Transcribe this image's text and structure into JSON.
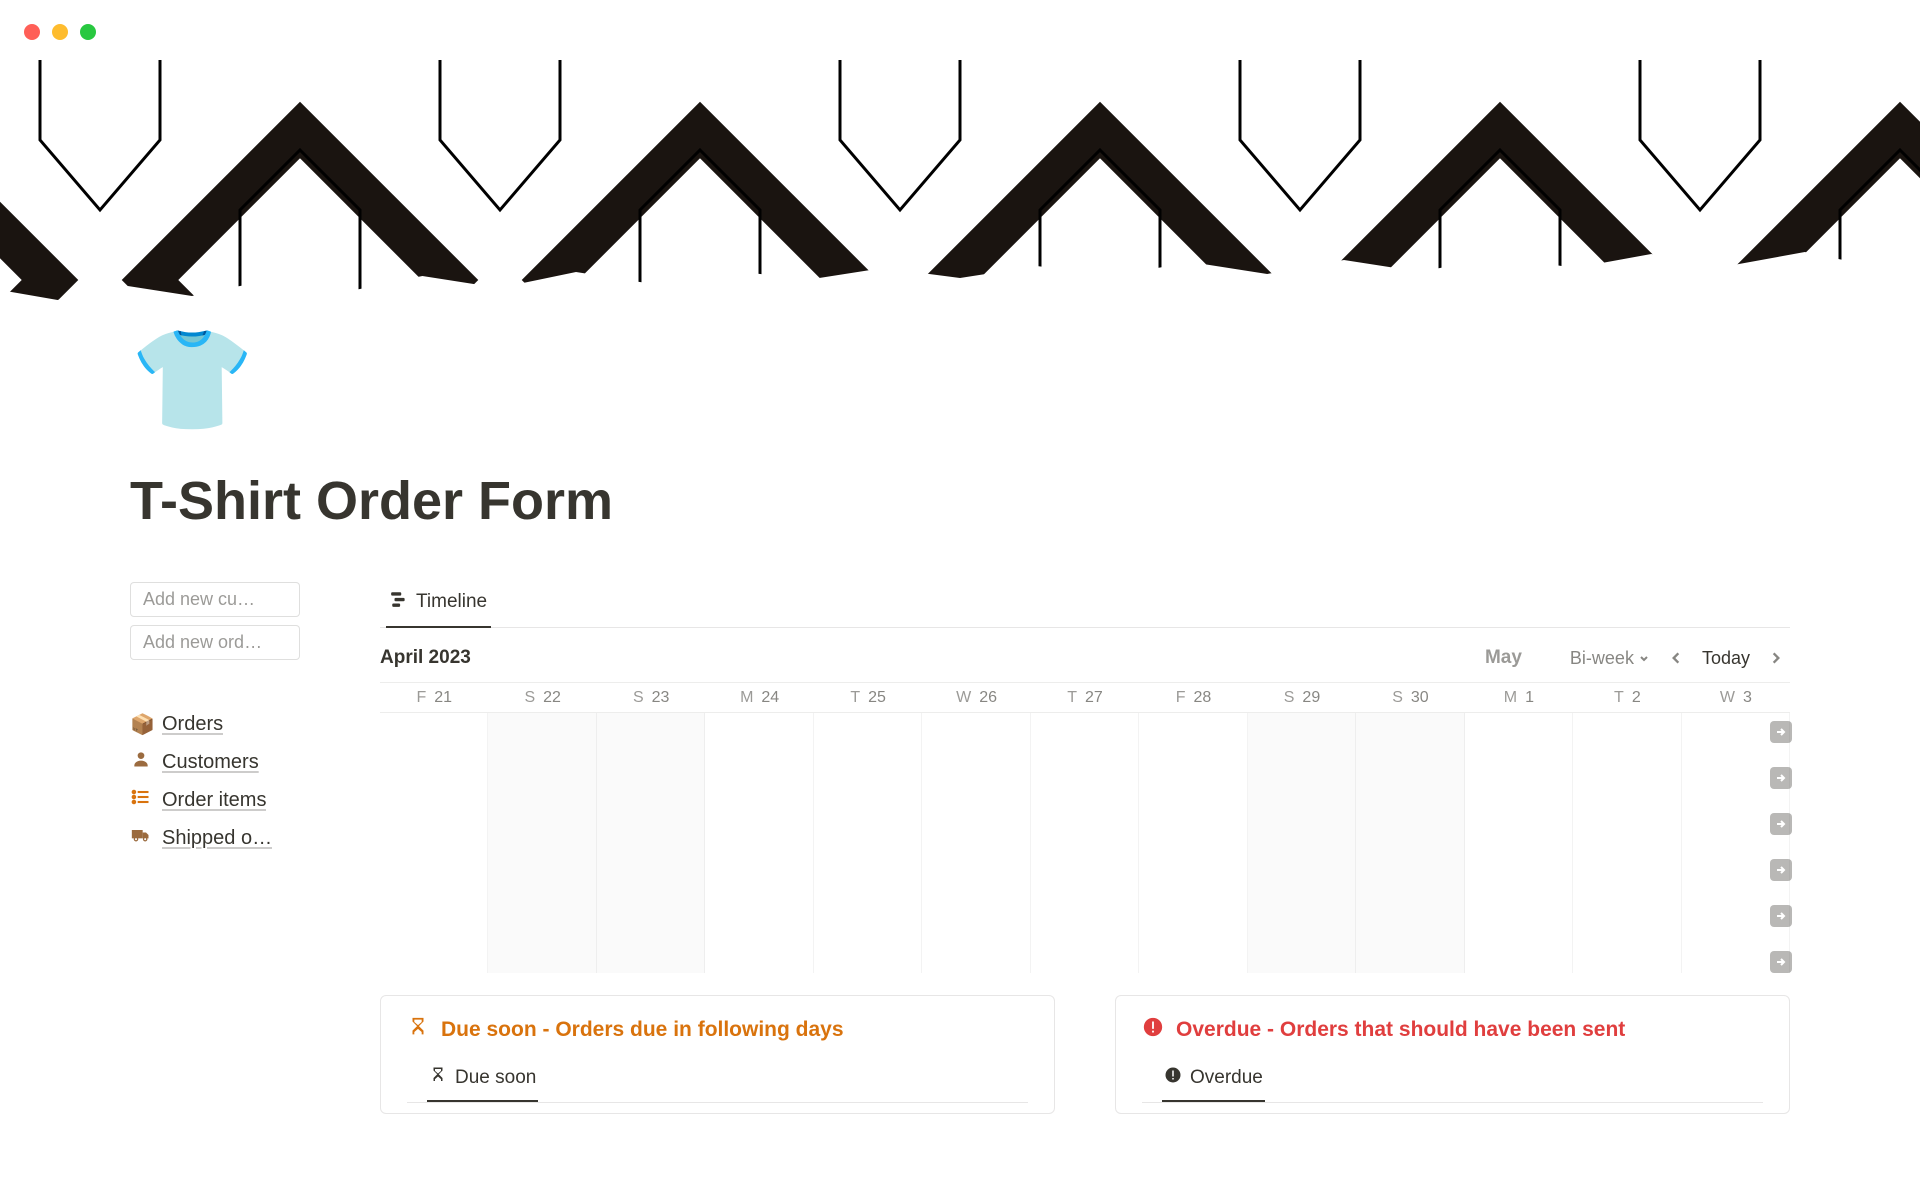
{
  "page": {
    "icon": "👕",
    "title": "T-Shirt Order Form"
  },
  "sidebar": {
    "add_buttons": [
      {
        "label": "Add new cu…"
      },
      {
        "label": "Add new ord…"
      }
    ],
    "nav": [
      {
        "icon": "📦",
        "label": "Orders"
      },
      {
        "icon": "👤",
        "label": "Customers"
      },
      {
        "icon": "📋",
        "label": "Order items"
      },
      {
        "icon": "🚚",
        "label": "Shipped o…"
      }
    ]
  },
  "timeline": {
    "tab_label": "Timeline",
    "month_primary": "April 2023",
    "month_secondary": "May",
    "scale_label": "Bi-week",
    "today_label": "Today",
    "days": [
      {
        "letter": "F",
        "num": "21",
        "weekend": false
      },
      {
        "letter": "S",
        "num": "22",
        "weekend": true
      },
      {
        "letter": "S",
        "num": "23",
        "weekend": true
      },
      {
        "letter": "M",
        "num": "24",
        "weekend": false
      },
      {
        "letter": "T",
        "num": "25",
        "weekend": false
      },
      {
        "letter": "W",
        "num": "26",
        "weekend": false
      },
      {
        "letter": "T",
        "num": "27",
        "weekend": false
      },
      {
        "letter": "F",
        "num": "28",
        "weekend": false
      },
      {
        "letter": "S",
        "num": "29",
        "weekend": true
      },
      {
        "letter": "S",
        "num": "30",
        "weekend": true
      },
      {
        "letter": "M",
        "num": "1",
        "weekend": false
      },
      {
        "letter": "T",
        "num": "2",
        "weekend": false
      },
      {
        "letter": "W",
        "num": "3",
        "weekend": false
      }
    ],
    "row_arrow_count": 6
  },
  "cards": {
    "due": {
      "title": "Due soon - Orders due in following days",
      "tab": "Due soon"
    },
    "overdue": {
      "title": "Overdue - Orders that should have been sent",
      "tab": "Overdue"
    }
  }
}
